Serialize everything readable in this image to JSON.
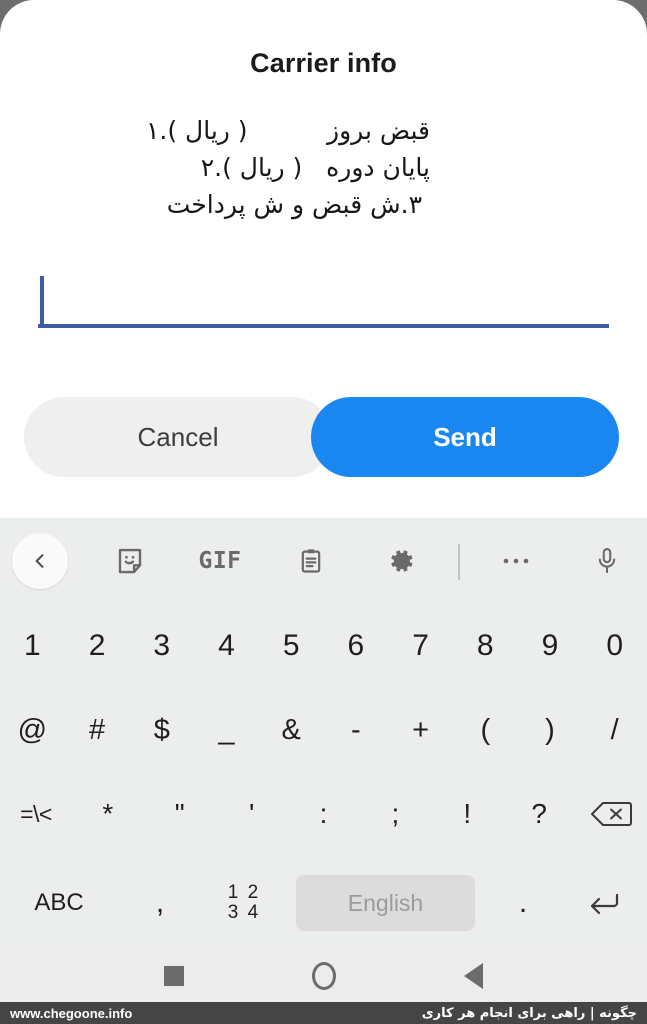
{
  "dialog": {
    "title": "Carrier info",
    "message_lines": [
      "قبض بروز          ( ریال ).۱",
      "پایان دوره   ( ریال ).۲",
      "۳.ش قبض و ش پرداخت"
    ],
    "input": {
      "value": "",
      "placeholder": ""
    },
    "cancel_label": "Cancel",
    "send_label": "Send"
  },
  "keyboard": {
    "toolbar": [
      {
        "name": "back-icon",
        "label": ""
      },
      {
        "name": "sticker-icon",
        "label": ""
      },
      {
        "name": "gif-icon",
        "label": "GIF"
      },
      {
        "name": "clipboard-icon",
        "label": ""
      },
      {
        "name": "gear-icon",
        "label": ""
      },
      {
        "name": "more-icon",
        "label": ""
      },
      {
        "name": "microphone-icon",
        "label": ""
      }
    ],
    "row_numbers": [
      "1",
      "2",
      "3",
      "4",
      "5",
      "6",
      "7",
      "8",
      "9",
      "0"
    ],
    "row_symbols": [
      "@",
      "#",
      "$",
      "_",
      "&",
      "-",
      "+",
      "(",
      ")",
      "/"
    ],
    "row_third": [
      "=\\<",
      "*",
      "\"",
      "'",
      ":",
      ";",
      "!",
      "?"
    ],
    "backspace_label": "",
    "bottom": {
      "abc_label": "ABC",
      "comma_label": ",",
      "numpad_top": "1 2",
      "numpad_bottom": "3 4",
      "space_label": "English",
      "period_label": ".",
      "enter_label": ""
    }
  },
  "navbar": {
    "recents_label": "",
    "home_label": "",
    "back_label": ""
  },
  "watermark": {
    "url": "www.chegoone.info",
    "tagline": "چگونه | راهی برای انجام هر کاری"
  },
  "colors": {
    "accent_blue": "#1a87f0",
    "input_blue": "#3f5aa6",
    "keyboard_bg": "#eceded",
    "cancel_bg": "#efefef",
    "watermark_bg": "#454545"
  }
}
